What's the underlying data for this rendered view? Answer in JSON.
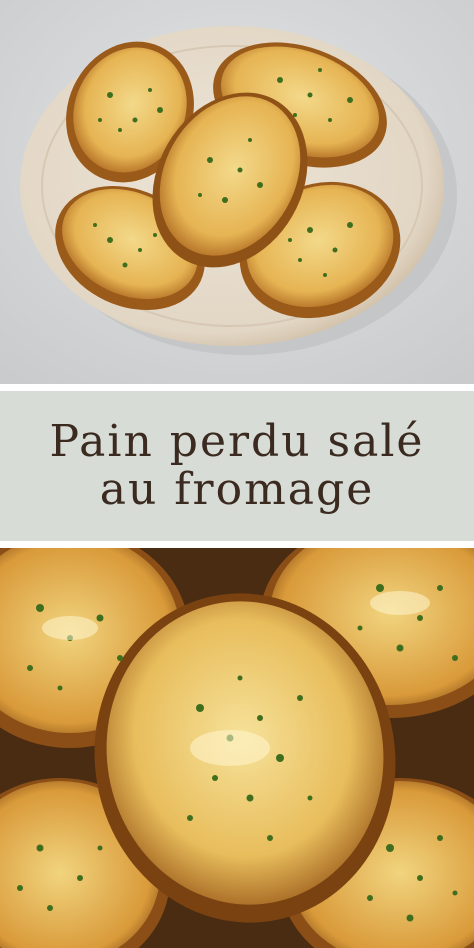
{
  "pin": {
    "title_line1": "Pain perdu salé",
    "title_line2": "au fromage"
  },
  "colors": {
    "band_background": "#d8dcd6",
    "title_text": "#3a2a20",
    "top_background": "#d9dbdd",
    "plate": "#e6ddd0",
    "toast": "#d99a3a",
    "toast_crust": "#9a5a1a",
    "cheese": "#f2d77c",
    "parsley": "#3f6e1e"
  }
}
